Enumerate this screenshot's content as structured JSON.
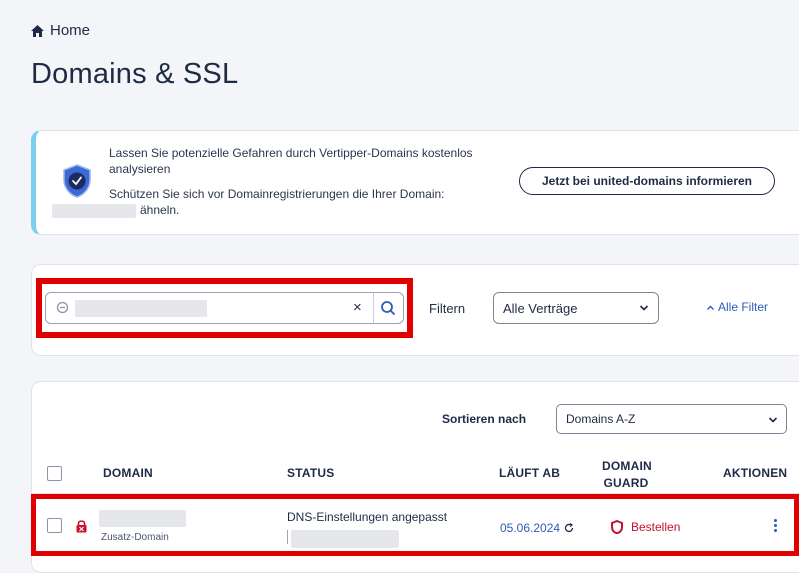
{
  "breadcrumb": {
    "home_label": "Home"
  },
  "page": {
    "title": "Domains & SSL"
  },
  "promo": {
    "line1": "Lassen Sie potenzielle Gefahren durch Vertipper-Domains kostenlos analysieren",
    "line2": "Schützen Sie sich vor Domainregistrierungen die Ihrer Domain:",
    "line3_suffix": "ähneln.",
    "cta_label": "Jetzt bei united-domains informieren"
  },
  "filter": {
    "search_value": "",
    "clear_symbol": "×",
    "filter_label": "Filtern",
    "contract_select": "Alle Verträge",
    "all_filters_label": "Alle Filter"
  },
  "table": {
    "sort_label": "Sortieren nach",
    "sort_select": "Domains A-Z",
    "headers": {
      "domain": "DOMAIN",
      "status": "STATUS",
      "expires": "LÄUFT AB",
      "guard_line1": "DOMAIN",
      "guard_line2": "GUARD",
      "actions": "AKTIONEN"
    },
    "rows": [
      {
        "domain_type": "Zusatz-Domain",
        "status": "DNS-Einstellungen angepasst",
        "expires": "05.06.2024",
        "guard_action": "Bestellen"
      }
    ]
  },
  "colors": {
    "accent": "#2f5bb5",
    "highlight": "#e10000",
    "order": "#c8102e"
  }
}
